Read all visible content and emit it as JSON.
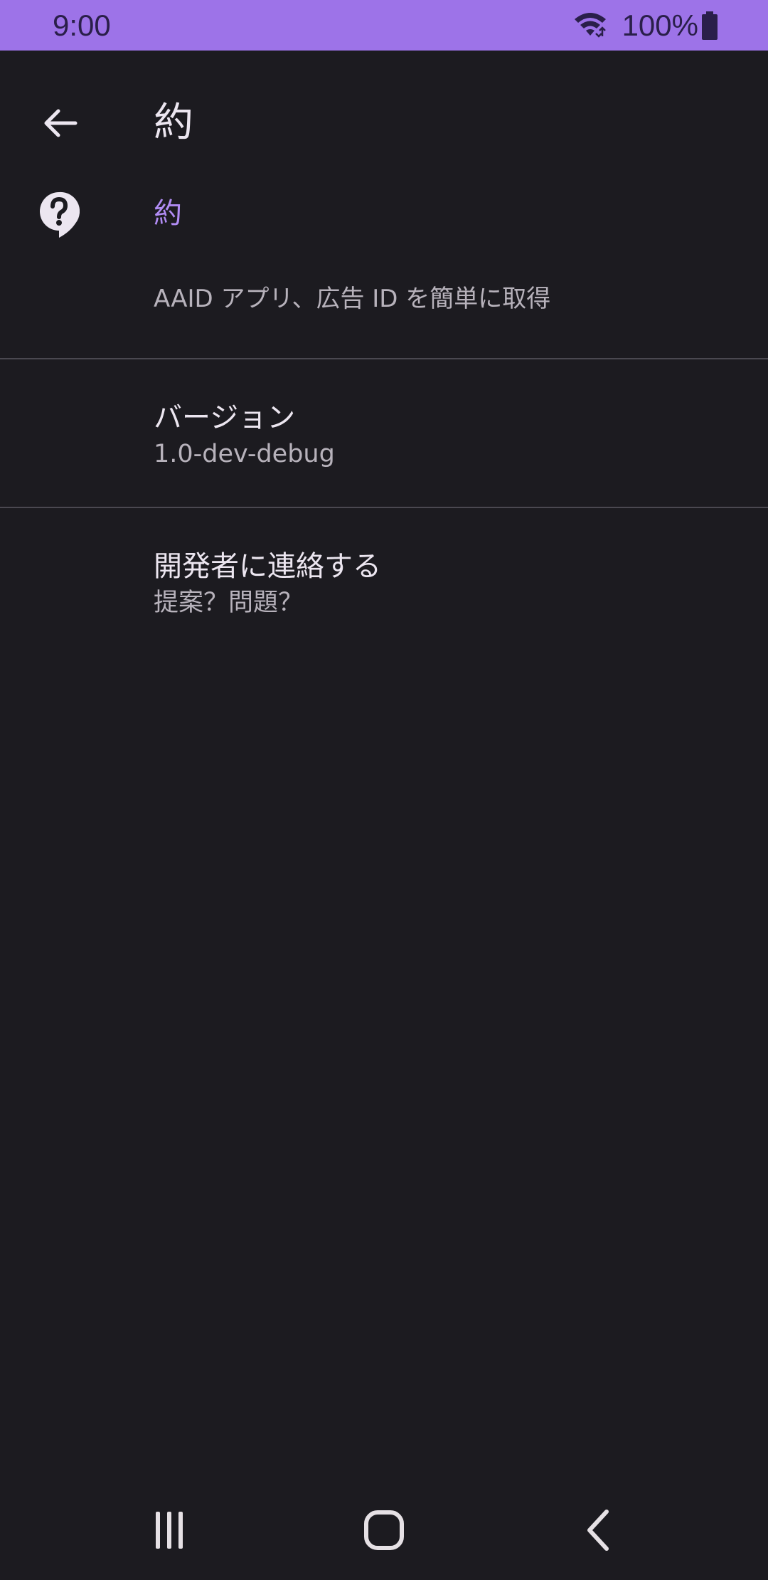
{
  "status_bar": {
    "time": "9:00",
    "battery": "100%",
    "icons": [
      "wifi-icon",
      "battery-icon"
    ]
  },
  "toolbar": {
    "back_icon": "arrow-back-icon",
    "title": "約"
  },
  "about_section": {
    "icon": "help-icon",
    "title": "約",
    "summary": "AAID アプリ、広告 ID を簡単に取得"
  },
  "preferences": [
    {
      "title": "バージョン",
      "summary": "1.0-dev-debug"
    },
    {
      "title": "開発者に連絡する",
      "summary": "提案？問題？"
    }
  ],
  "nav_bar": {
    "icons": [
      "recents-icon",
      "home-icon",
      "nav-back-icon"
    ]
  },
  "colors": {
    "status_bar": "#9d73e8",
    "background": "#1c1b20",
    "accent": "#b18cf4",
    "divider": "#4a4850"
  }
}
